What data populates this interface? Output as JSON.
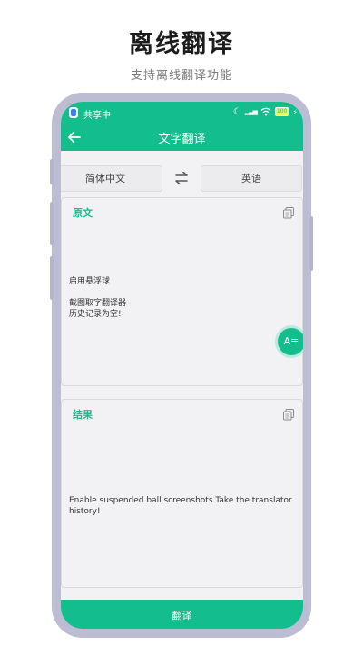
{
  "promo": {
    "title": "离线翻译",
    "subtitle": "支持离线翻译功能"
  },
  "status_bar": {
    "left_text": "共享中",
    "battery": "100"
  },
  "nav": {
    "title": "文字翻译"
  },
  "languages": {
    "source": "简体中文",
    "target": "英语"
  },
  "source_card": {
    "title": "原文",
    "text": "启用悬浮球\n\n截图取字翻译器\n历史记录为空!"
  },
  "result_card": {
    "title": "结果",
    "text": "Enable suspended ball screenshots Take the translator history!"
  },
  "fab": {
    "label": "A≡"
  },
  "translate_button": {
    "label": "翻译"
  },
  "colors": {
    "accent": "#14be8c",
    "phone_frame": "#bcbdd3",
    "screen_bg": "#f2f2f4"
  }
}
